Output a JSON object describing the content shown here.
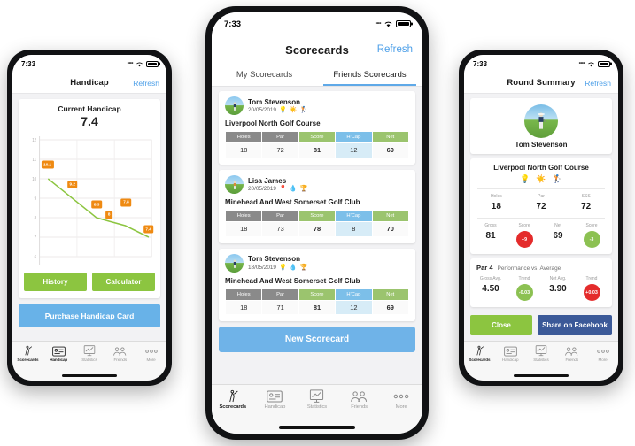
{
  "status_bar": {
    "time": "7:33"
  },
  "left_phone": {
    "nav": {
      "title": "Handicap",
      "action": "Refresh"
    },
    "handicap": {
      "title": "Current Handicap",
      "value": "7.4"
    },
    "buttons": {
      "history": "History",
      "calculator": "Calculator",
      "purchase": "Purchase Handicap Card"
    },
    "chart_data": {
      "type": "line",
      "title": "Current Handicap",
      "xlabel": "",
      "ylabel": "",
      "ylim": [
        6,
        12
      ],
      "yticks": [
        "12",
        "11",
        "10",
        "9",
        "8",
        "7",
        "6"
      ],
      "grid": true,
      "legend": "none",
      "line_color": "#8cc540",
      "point_label_color": "#ef8a12",
      "categories": [
        "1",
        "2",
        "3",
        "4",
        "5",
        "6"
      ],
      "values": [
        10.1,
        9.2,
        8.3,
        8.0,
        7.8,
        7.4
      ],
      "point_labels": [
        "10.1",
        "9.2",
        "8.3",
        "8",
        "7.8",
        "7.4"
      ]
    },
    "tabs": [
      {
        "label": "Scorecards",
        "icon": "golfer-icon",
        "active": false
      },
      {
        "label": "Handicap",
        "icon": "card-icon",
        "active": true
      },
      {
        "label": "Statistics",
        "icon": "chart-icon",
        "active": false
      },
      {
        "label": "Friends",
        "icon": "people-icon",
        "active": false
      },
      {
        "label": "More",
        "icon": "ellipsis-icon",
        "active": false
      }
    ]
  },
  "center_phone": {
    "nav": {
      "title": "Scorecards",
      "action": "Refresh"
    },
    "segments": [
      {
        "label": "My Scorecards",
        "active": false
      },
      {
        "label": "Friends Scorecards",
        "active": true
      }
    ],
    "columns": [
      "Holes",
      "Par",
      "Score",
      "H'Cap",
      "Net"
    ],
    "scorecards": [
      {
        "player": "Tom Stevenson",
        "date": "20/05/2019",
        "emojis": [
          "💡",
          "☀️",
          "🏌️"
        ],
        "course": "Liverpool North Golf Course",
        "values": [
          "18",
          "72",
          "81",
          "12",
          "69"
        ]
      },
      {
        "player": "Lisa James",
        "date": "20/05/2019",
        "emojis": [
          "📍",
          "💧",
          "🏆"
        ],
        "course": "Minehead And West Somerset Golf Club",
        "values": [
          "18",
          "73",
          "78",
          "8",
          "70"
        ]
      },
      {
        "player": "Tom Stevenson",
        "date": "18/05/2019",
        "emojis": [
          "💡",
          "💧",
          "🏆"
        ],
        "course": "Minehead And West Somerset Golf Club",
        "values": [
          "18",
          "71",
          "81",
          "12",
          "69"
        ]
      }
    ],
    "new_scorecard": "New Scorecard",
    "tabs": [
      {
        "label": "Scorecards",
        "icon": "golfer-icon",
        "active": true
      },
      {
        "label": "Handicap",
        "icon": "card-icon",
        "active": false
      },
      {
        "label": "Statistics",
        "icon": "chart-icon",
        "active": false
      },
      {
        "label": "Friends",
        "icon": "people-icon",
        "active": false
      },
      {
        "label": "More",
        "icon": "ellipsis-icon",
        "active": false
      }
    ]
  },
  "right_phone": {
    "nav": {
      "title": "Round Summary",
      "action": "Refresh"
    },
    "player": "Tom Stevenson",
    "course": "Liverpool North Golf Course",
    "emojis": [
      "💡",
      "☀️",
      "🏌️"
    ],
    "round_stats": [
      {
        "label": "Holes",
        "value": "18"
      },
      {
        "label": "Par",
        "value": "72"
      },
      {
        "label": "SSS",
        "value": "72"
      }
    ],
    "score_stats": [
      {
        "label": "Gross",
        "value": "81",
        "type": "text"
      },
      {
        "label": "Score",
        "value": "+9",
        "type": "bubble-red"
      },
      {
        "label": "Net",
        "value": "69",
        "type": "text"
      },
      {
        "label": "Score",
        "value": "-3",
        "type": "bubble-green"
      }
    ],
    "par_section": {
      "title": "Par 4",
      "subtitle": "Performance vs. Average",
      "stats": [
        {
          "label": "Gross Avg.",
          "value": "4.50",
          "type": "text"
        },
        {
          "label": "Trend",
          "value": "-0.03",
          "type": "bubble-green"
        },
        {
          "label": "Net Avg.",
          "value": "3.90",
          "type": "text"
        },
        {
          "label": "Trend",
          "value": "+0.03",
          "type": "bubble-red"
        }
      ]
    },
    "buttons": {
      "close": "Close",
      "share": "Share on Facebook"
    },
    "tabs": [
      {
        "label": "Scorecards",
        "icon": "golfer-icon",
        "active": true
      },
      {
        "label": "Handicap",
        "icon": "card-icon",
        "active": false
      },
      {
        "label": "Statistics",
        "icon": "chart-icon",
        "active": false
      },
      {
        "label": "Friends",
        "icon": "people-icon",
        "active": false
      },
      {
        "label": "More",
        "icon": "ellipsis-icon",
        "active": false
      }
    ]
  },
  "colors": {
    "green": "#8cc540",
    "blue": "#68b2e8",
    "orange": "#ef8a12",
    "red": "#e42b2b",
    "facebook": "#3b5998",
    "link": "#4c9fe8"
  }
}
